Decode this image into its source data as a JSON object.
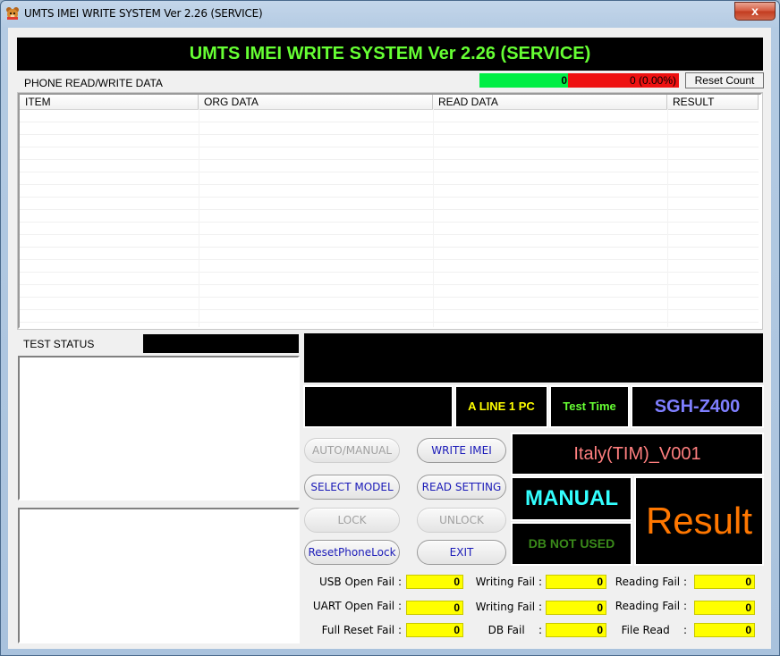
{
  "window": {
    "title": "UMTS IMEI WRITE SYSTEM Ver 2.26 (SERVICE)",
    "close_label": "x"
  },
  "banner": {
    "title": "UMTS IMEI WRITE SYSTEM Ver 2.26 (SERVICE)"
  },
  "phone_data": {
    "label": "PHONE READ/WRITE DATA",
    "columns": [
      "ITEM",
      "ORG DATA",
      "READ DATA",
      "RESULT"
    ],
    "rows": []
  },
  "counters_bar": {
    "pass_count": "0",
    "fail_count": "0 (0.00%)",
    "reset_label": "Reset Count"
  },
  "test_status": {
    "label": "TEST STATUS"
  },
  "info": {
    "line": "A LINE  1 PC",
    "test_time": "Test Time",
    "model": "SGH-Z400",
    "region": "Italy(TIM)_V001",
    "mode": "MANUAL",
    "db": "DB NOT USED",
    "result": "Result"
  },
  "buttons": {
    "auto_manual": "AUTO/MANUAL",
    "write_imei": "WRITE IMEI",
    "select_model": "SELECT MODEL",
    "read_setting": "READ SETTING",
    "lock": "LOCK",
    "unlock": "UNLOCK",
    "reset_phone_lock": "ResetPhoneLock",
    "exit": "EXIT"
  },
  "fail_counts": [
    {
      "label": "USB Open Fail :",
      "value": "0"
    },
    {
      "label": "Writing Fail :",
      "value": "0"
    },
    {
      "label": "Reading Fail :",
      "value": "0"
    },
    {
      "label": "UART Open Fail :",
      "value": "0"
    },
    {
      "label": "Writing Fail :",
      "value": "0"
    },
    {
      "label": "Reading Fail :",
      "value": "0"
    },
    {
      "label": "Full Reset Fail :",
      "value": "0"
    },
    {
      "label": "DB Fail    :",
      "value": "0"
    },
    {
      "label": "File Read    :",
      "value": "0"
    }
  ],
  "colors": {
    "banner_text": "#66ff33",
    "pass": "#00ee44",
    "fail": "#ee1111",
    "line_text": "#ffff00",
    "test_time_text": "#66ff33",
    "model_text": "#7f7fff",
    "region_text": "#ff7f7f",
    "mode_text": "#33ffff",
    "db_text": "#3a8a1a",
    "result_text": "#ff7700",
    "counter_bg": "#ffff00"
  }
}
